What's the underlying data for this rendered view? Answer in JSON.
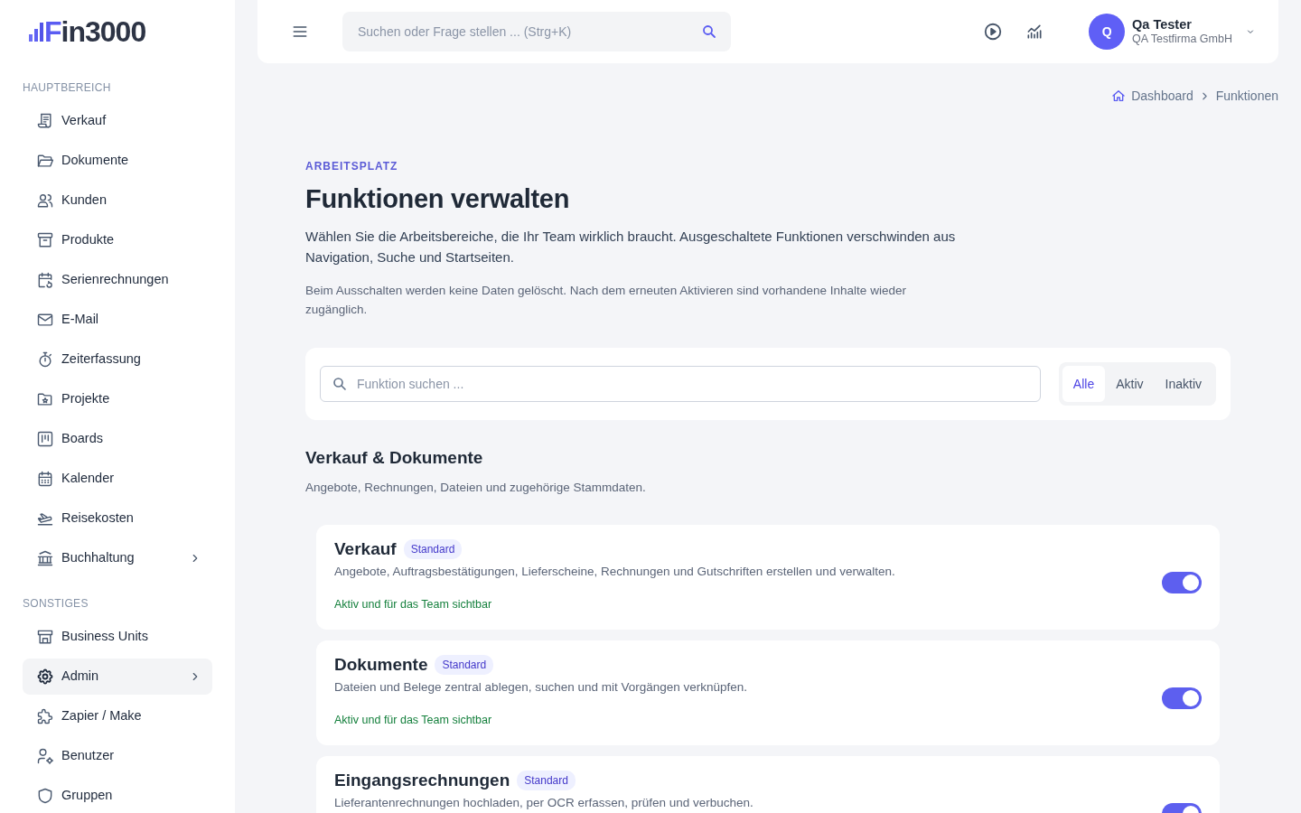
{
  "sidebar": {
    "logo": "Fin3000",
    "sections": [
      {
        "title": "HAUPTBEREICH",
        "items": [
          {
            "label": "Verkauf",
            "selected": false,
            "expandable": false
          },
          {
            "label": "Dokumente",
            "selected": false,
            "expandable": false
          },
          {
            "label": "Kunden",
            "selected": false,
            "expandable": false
          },
          {
            "label": "Produkte",
            "selected": false,
            "expandable": false
          },
          {
            "label": "Serienrechnungen",
            "selected": false,
            "expandable": false
          },
          {
            "label": "E-Mail",
            "selected": false,
            "expandable": false
          },
          {
            "label": "Zeiterfassung",
            "selected": false,
            "expandable": false
          },
          {
            "label": "Projekte",
            "selected": false,
            "expandable": false
          },
          {
            "label": "Boards",
            "selected": false,
            "expandable": false
          },
          {
            "label": "Kalender",
            "selected": false,
            "expandable": false
          },
          {
            "label": "Reisekosten",
            "selected": false,
            "expandable": false
          },
          {
            "label": "Buchhaltung",
            "selected": false,
            "expandable": true
          }
        ]
      },
      {
        "title": "SONSTIGES",
        "items": [
          {
            "label": "Business Units",
            "selected": false,
            "expandable": false
          },
          {
            "label": "Admin",
            "selected": true,
            "expandable": true
          },
          {
            "label": "Zapier / Make",
            "selected": false,
            "expandable": false
          },
          {
            "label": "Benutzer",
            "selected": false,
            "expandable": false
          },
          {
            "label": "Gruppen",
            "selected": false,
            "expandable": false
          }
        ]
      }
    ]
  },
  "topbar": {
    "search": {
      "placeholder": "Suchen oder Frage stellen ... (Strg+K)"
    },
    "user": {
      "initial": "Q",
      "name": "Qa Tester",
      "company": "QA Testfirma GmbH"
    }
  },
  "breadcrumb": [
    {
      "label": "Dashboard"
    },
    {
      "label": "Funktionen"
    }
  ],
  "header": {
    "eyebrow": "ARBEITSPLATZ",
    "title": "Funktionen verwalten",
    "lead": "Wählen Sie die Arbeitsbereiche, die Ihr Team wirklich braucht. Ausgeschaltete Funktionen verschwinden aus Navigation, Suche und Startseiten.",
    "note": "Beim Ausschalten werden keine Daten gelöscht. Nach dem erneuten Aktivieren sind vorhandene Inhalte wieder zugänglich."
  },
  "filter": {
    "placeholder": "Funktion suchen ...",
    "segments": [
      {
        "label": "Alle",
        "selected": true
      },
      {
        "label": "Aktiv",
        "selected": false
      },
      {
        "label": "Inaktiv",
        "selected": false
      }
    ]
  },
  "groups": [
    {
      "title": "Verkauf & Dokumente",
      "description": "Angebote, Rechnungen, Dateien und zugehörige Stammdaten.",
      "features": [
        {
          "name": "Verkauf",
          "badge": "Standard",
          "description": "Angebote, Auftragsbestätigungen, Lieferscheine, Rechnungen und Gutschriften erstellen und verwalten.",
          "status": "Aktiv und für das Team sichtbar",
          "on": true
        },
        {
          "name": "Dokumente",
          "badge": "Standard",
          "description": "Dateien und Belege zentral ablegen, suchen und mit Vorgängen verknüpfen.",
          "status": "Aktiv und für das Team sichtbar",
          "on": true
        },
        {
          "name": "Eingangsrechnungen",
          "badge": "Standard",
          "description": "Lieferantenrechnungen hochladen, per OCR erfassen, prüfen und verbuchen.",
          "on": true
        }
      ]
    }
  ]
}
